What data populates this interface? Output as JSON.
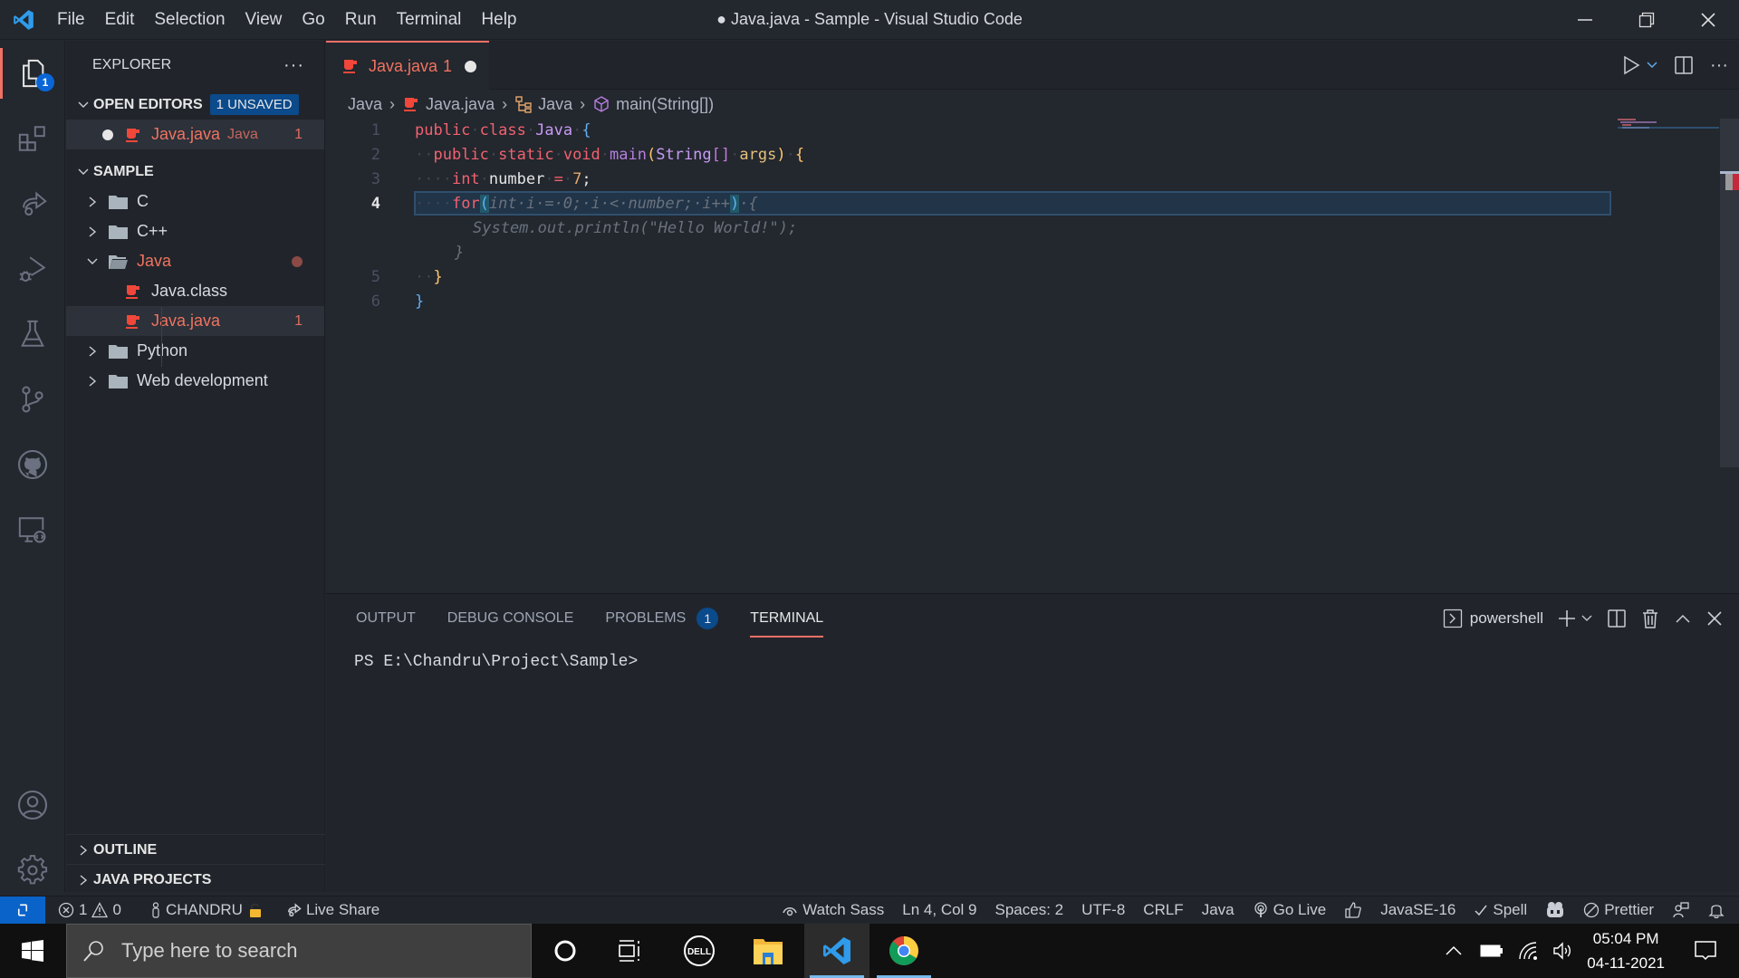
{
  "window": {
    "title": "● Java.java - Sample - Visual Studio Code",
    "menu": [
      "File",
      "Edit",
      "Selection",
      "View",
      "Go",
      "Run",
      "Terminal",
      "Help"
    ]
  },
  "activity_bar": {
    "items": [
      {
        "name": "explorer",
        "badge": "1",
        "active": true
      },
      {
        "name": "extensions"
      },
      {
        "name": "live-share"
      },
      {
        "name": "run-debug"
      },
      {
        "name": "testing"
      },
      {
        "name": "source-control"
      },
      {
        "name": "github"
      },
      {
        "name": "remote-explorer"
      }
    ],
    "bottom": [
      "accounts",
      "manage"
    ]
  },
  "sidebar": {
    "title": "EXPLORER",
    "more": "···",
    "open_editors": {
      "label": "OPEN EDITORS",
      "badge": "1 UNSAVED",
      "items": [
        {
          "name": "Java.java",
          "folder": "Java",
          "problems": "1",
          "dirty": true
        }
      ]
    },
    "workspace": {
      "label": "SAMPLE",
      "tree": [
        {
          "name": "C",
          "type": "folder",
          "expanded": false
        },
        {
          "name": "C++",
          "type": "folder",
          "expanded": false
        },
        {
          "name": "Java",
          "type": "folder",
          "expanded": true,
          "modified": true
        },
        {
          "name": "Java.class",
          "type": "file"
        },
        {
          "name": "Java.java",
          "type": "file",
          "problems": "1",
          "selected": true
        },
        {
          "name": "Python",
          "type": "folder",
          "expanded": false
        },
        {
          "name": "Web development",
          "type": "folder",
          "expanded": false
        }
      ]
    },
    "outline": "OUTLINE",
    "java_projects": "JAVA PROJECTS"
  },
  "editor": {
    "tab": {
      "label": "Java.java",
      "problems": "1",
      "dirty": true
    },
    "breadcrumb": [
      "Java",
      "Java.java",
      "Java",
      "main(String[])"
    ],
    "lines": [
      {
        "n": "1",
        "text": "public class Java {"
      },
      {
        "n": "2",
        "text": "  public static void main(String[] args) {"
      },
      {
        "n": "3",
        "text": "    int number = 7;"
      },
      {
        "n": "4",
        "text": "    for(int i = 0; i < number; i++) {"
      },
      {
        "n": "",
        "text": "      System.out.println(\"Hello World!\");"
      },
      {
        "n": "",
        "text": "    }"
      },
      {
        "n": "5",
        "text": "  }"
      },
      {
        "n": "6",
        "text": "}"
      }
    ],
    "current_line": "4",
    "ghost_text": {
      "line4_suffix": "int i = 0; i < number; i++) {",
      "line5": "System.out.println(\"Hello World!\");",
      "line6": "}"
    }
  },
  "panel": {
    "tabs": [
      {
        "label": "OUTPUT"
      },
      {
        "label": "DEBUG CONSOLE"
      },
      {
        "label": "PROBLEMS",
        "badge": "1"
      },
      {
        "label": "TERMINAL",
        "active": true
      }
    ],
    "terminal_name": "powershell",
    "terminal_text": "PS E:\\Chandru\\Project\\Sample>"
  },
  "status_bar": {
    "errors": "1",
    "warnings": "0",
    "user": "CHANDRU",
    "live_share": "Live Share",
    "watch_sass": "Watch Sass",
    "cursor": "Ln 4, Col 9",
    "indent": "Spaces: 2",
    "encoding": "UTF-8",
    "eol": "CRLF",
    "language": "Java",
    "go_live": "Go Live",
    "java_version": "JavaSE-16",
    "spell": "Spell",
    "prettier": "Prettier"
  },
  "taskbar": {
    "search_placeholder": "Type here to search",
    "time": "05:04 PM",
    "date": "04-11-2021",
    "apps": [
      "cortana",
      "task-view",
      "dell",
      "file-explorer",
      "vscode",
      "chrome"
    ]
  },
  "colors": {
    "accent": "#f07166",
    "remote": "#0a63c9",
    "badge": "#0b4a8b",
    "java_icon": "#f0473a"
  }
}
